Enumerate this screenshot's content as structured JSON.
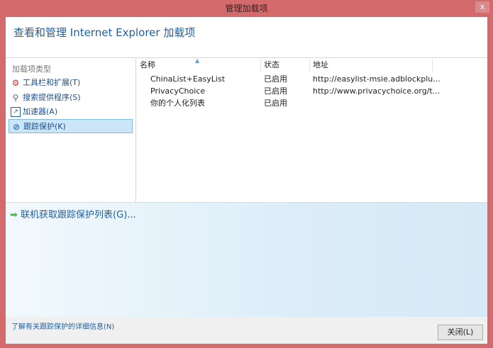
{
  "window": {
    "title": "管理加载项",
    "close": "x"
  },
  "header": {
    "title": "查看和管理 Internet Explorer 加载项"
  },
  "sidebar": {
    "heading": "加载项类型",
    "items": [
      {
        "label": "工具栏和扩展(T)"
      },
      {
        "label": "搜索提供程序(S)"
      },
      {
        "label": "加速器(A)"
      },
      {
        "label": "跟踪保护(K)",
        "selected": true
      }
    ]
  },
  "list": {
    "columns": [
      "名称",
      "状态",
      "地址"
    ],
    "rows": [
      {
        "name": "ChinaList+EasyList",
        "status": "已启用",
        "address": "http://easylist-msie.adblockplu..."
      },
      {
        "name": "PrivacyChoice",
        "status": "已启用",
        "address": "http://www.privacychoice.org/t..."
      },
      {
        "name": "你的个人化列表",
        "status": "已启用",
        "address": ""
      }
    ]
  },
  "details": {
    "get_list_link": "联机获取跟踪保护列表(G)..."
  },
  "footer": {
    "more_info_link": "了解有关跟踪保护的详细信息(N)",
    "close_button": "关闭(L)"
  }
}
